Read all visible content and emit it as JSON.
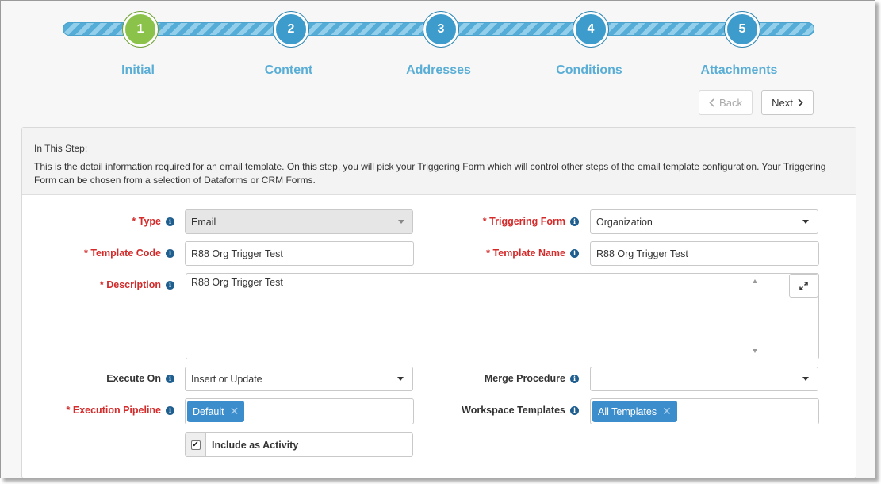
{
  "steps": [
    {
      "number": "1",
      "label": "Initial",
      "active": true
    },
    {
      "number": "2",
      "label": "Content"
    },
    {
      "number": "3",
      "label": "Addresses"
    },
    {
      "number": "4",
      "label": "Conditions"
    },
    {
      "number": "5",
      "label": "Attachments"
    }
  ],
  "nav": {
    "back_label": "Back",
    "next_label": "Next"
  },
  "info": {
    "title": "In This Step:",
    "text": "This is the detail information required for an email template. On this step, you will pick your Triggering Form which will control other steps of the email template configuration. Your Triggering Form can be chosen from a selection of Dataforms or CRM Forms."
  },
  "form": {
    "type": {
      "label": "Type",
      "value": "Email"
    },
    "triggering_form": {
      "label": "Triggering Form",
      "value": "Organization"
    },
    "template_code": {
      "label": "Template Code",
      "value": "R88 Org Trigger Test"
    },
    "template_name": {
      "label": "Template Name",
      "value": "R88 Org Trigger Test"
    },
    "description": {
      "label": "Description",
      "value": "R88 Org Trigger Test"
    },
    "execute_on": {
      "label": "Execute On",
      "value": "Insert or Update"
    },
    "merge_procedure": {
      "label": "Merge Procedure",
      "value": ""
    },
    "execution_pipeline": {
      "label": "Execution Pipeline",
      "tag": "Default"
    },
    "workspace_templates": {
      "label": "Workspace Templates",
      "tag": "All Templates"
    },
    "include_activity": {
      "label": "Include as Activity",
      "checked": true
    }
  },
  "required_mark": "*",
  "icons": {
    "info": "info-icon",
    "expand": "expand-icon",
    "remove": "remove-tag-icon",
    "check": "check-icon"
  },
  "colors": {
    "accent": "#5aaed6",
    "active_step": "#8bc34a",
    "required": "#d42a2a",
    "tag": "#3c8dcc"
  }
}
